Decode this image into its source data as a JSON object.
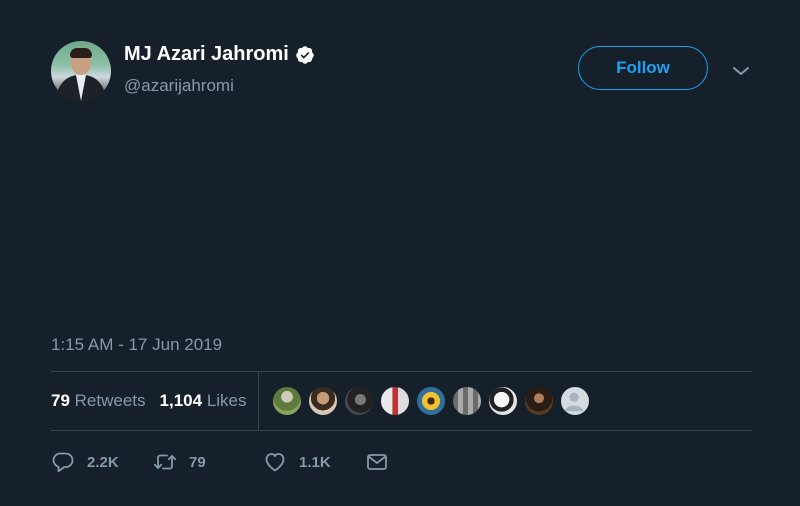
{
  "author": {
    "display_name": "MJ Azari Jahromi",
    "handle": "@azarijahromi",
    "verified": true
  },
  "header": {
    "follow_label": "Follow",
    "menu_icon": "chevron-down-icon"
  },
  "tweet": {
    "timestamp": "1:15 AM - 17 Jun 2019"
  },
  "stats": {
    "retweets_count": "79",
    "retweets_label": "Retweets",
    "likes_count": "1,104",
    "likes_label": "Likes"
  },
  "likers": [
    {
      "name": "liker-avatar-1"
    },
    {
      "name": "liker-avatar-2"
    },
    {
      "name": "liker-avatar-3"
    },
    {
      "name": "liker-avatar-4"
    },
    {
      "name": "liker-avatar-5"
    },
    {
      "name": "liker-avatar-6"
    },
    {
      "name": "liker-avatar-7"
    },
    {
      "name": "liker-avatar-8"
    },
    {
      "name": "liker-avatar-9"
    }
  ],
  "actions": {
    "reply_count": "2.2K",
    "retweet_count": "79",
    "like_count": "1.1K"
  },
  "colors": {
    "background": "#15202b",
    "accent": "#1da1f2",
    "secondary_text": "#8899a6",
    "divider": "#38444d"
  }
}
